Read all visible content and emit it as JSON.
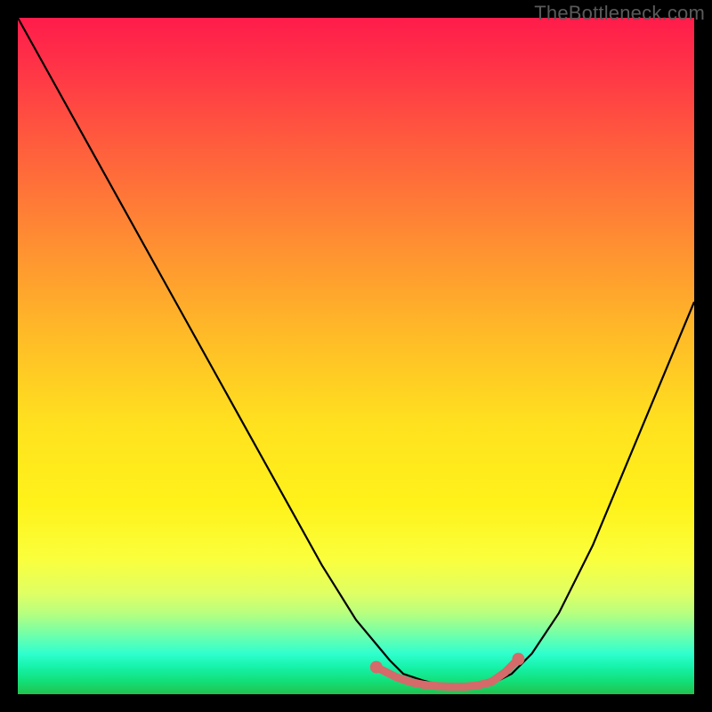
{
  "watermark": "TheBottleneck.com",
  "chart_data": {
    "type": "line",
    "title": "",
    "xlabel": "",
    "ylabel": "",
    "xlim": [
      0,
      100
    ],
    "ylim": [
      0,
      100
    ],
    "grid": false,
    "legend": false,
    "series": [
      {
        "name": "bottleneck-curve",
        "x": [
          0,
          5,
          10,
          15,
          20,
          25,
          30,
          35,
          40,
          45,
          50,
          55,
          57,
          60,
          62,
          65,
          68,
          70,
          73,
          76,
          80,
          85,
          90,
          95,
          100
        ],
        "y": [
          100,
          91,
          82,
          73,
          64,
          55,
          46,
          37,
          28,
          19,
          11,
          5,
          3,
          2,
          1.5,
          1.2,
          1.2,
          1.5,
          3,
          6,
          12,
          22,
          34,
          46,
          58
        ]
      }
    ],
    "trough": {
      "x": [
        53,
        56,
        58,
        60,
        62,
        64,
        66,
        68,
        70,
        72,
        74
      ],
      "y": [
        4.0,
        2.5,
        1.8,
        1.4,
        1.2,
        1.1,
        1.1,
        1.3,
        1.8,
        3.2,
        5.2
      ]
    },
    "background_gradient": {
      "top": "#ff1c4a",
      "middle": "#ffd820",
      "bottom": "#22c24d"
    }
  }
}
